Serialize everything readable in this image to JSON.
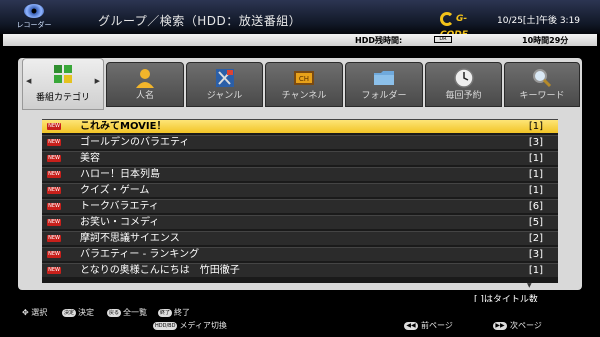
{
  "header": {
    "logo_label": "レコーダー",
    "title": "グループ／検索（HDD：放送番組）",
    "gcode_label": "G-CODE",
    "datetime": "10/25[土]午後 3:19"
  },
  "hdd": {
    "label": "HDD残時間:",
    "mode": "DR",
    "remaining": "10時間29分"
  },
  "tabs": [
    {
      "label": "番組カテゴリ",
      "icon": "category-grid-icon",
      "active": true
    },
    {
      "label": "人名",
      "icon": "person-icon"
    },
    {
      "label": "ジャンル",
      "icon": "genre-tools-icon"
    },
    {
      "label": "チャンネル",
      "icon": "channel-tv-icon"
    },
    {
      "label": "フォルダー",
      "icon": "folder-icon"
    },
    {
      "label": "毎回予約",
      "icon": "clock-icon"
    },
    {
      "label": "キーワード",
      "icon": "magnifier-icon"
    }
  ],
  "new_badge": "NEW",
  "list": [
    {
      "name": "これみてMOVIE！",
      "count": "[1]"
    },
    {
      "name": "ゴールデンのバラエティ",
      "count": "[3]"
    },
    {
      "name": "美容",
      "count": "[1]"
    },
    {
      "name": "ハロー！日本列島",
      "count": "[1]"
    },
    {
      "name": "クイズ・ゲーム",
      "count": "[1]"
    },
    {
      "name": "トークバラエティ",
      "count": "[6]"
    },
    {
      "name": "お笑い・コメディ",
      "count": "[5]"
    },
    {
      "name": "摩訶不思議サイエンス",
      "count": "[2]"
    },
    {
      "name": "バラエティー - ランキング",
      "count": "[3]"
    },
    {
      "name": "となりの奥様こんにちは　竹田徹子",
      "count": "[1]"
    }
  ],
  "note": "[ ]はタイトル数",
  "footer": {
    "select_label": "選択",
    "enter_key": "決定",
    "enter_label": "決定",
    "list_key": "戻る",
    "list_label": "全一覧",
    "end_key": "終了",
    "end_label": "終了",
    "media_key": "HDD/BD",
    "media_label": "メディア切換",
    "prev_label": "前ページ",
    "next_label": "次ページ"
  },
  "colors": {
    "selected_row": "#f2c426",
    "row_bg": "#2b2b2b",
    "panel_bg": "#d9d9d9",
    "new_badge": "#c8201b",
    "gcode": "#f2c21a"
  }
}
